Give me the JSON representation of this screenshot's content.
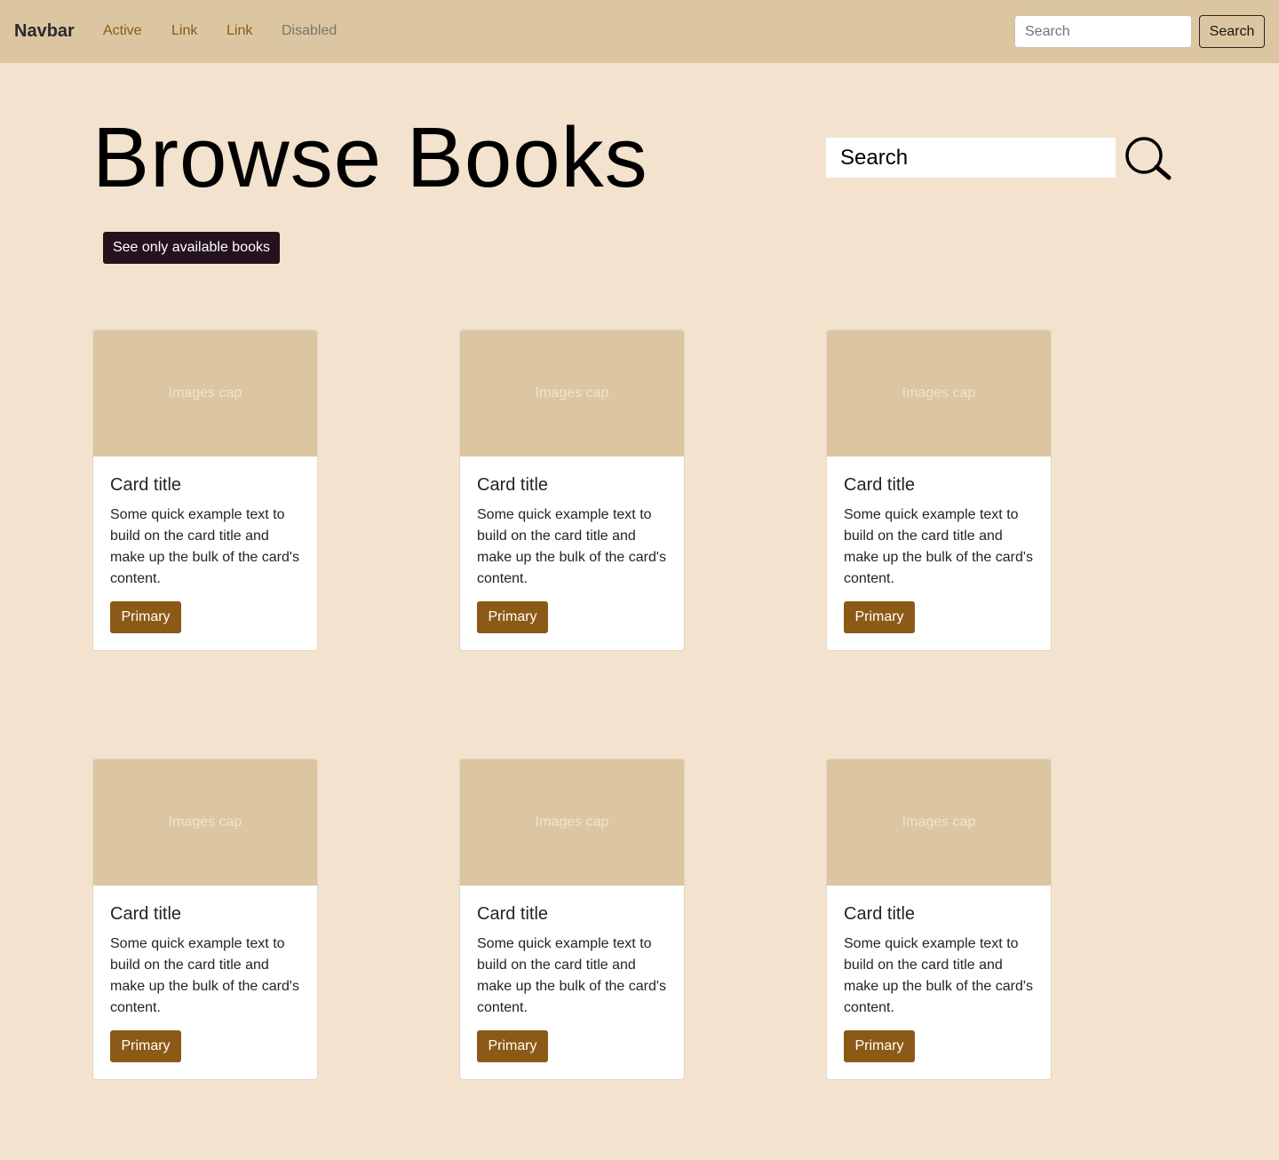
{
  "navbar": {
    "brand": "Navbar",
    "links": [
      {
        "label": "Active",
        "state": "active"
      },
      {
        "label": "Link",
        "state": "normal"
      },
      {
        "label": "Link",
        "state": "normal"
      },
      {
        "label": "Disabled",
        "state": "disabled"
      }
    ],
    "search_placeholder": "Search",
    "search_button": "Search"
  },
  "header": {
    "title": "Browse Books",
    "search_placeholder": "Search",
    "filter_button": "See only available books"
  },
  "cards": [
    {
      "image_caption": "Images cap",
      "title": "Card title",
      "text": "Some quick example text to build on the card title and make up the bulk of the card's content.",
      "button": "Primary"
    },
    {
      "image_caption": "Images cap",
      "title": "Card title",
      "text": "Some quick example text to build on the card title and make up the bulk of the card's content.",
      "button": "Primary"
    },
    {
      "image_caption": "Images cap",
      "title": "Card title",
      "text": "Some quick example text to build on the card title and make up the bulk of the card's content.",
      "button": "Primary"
    },
    {
      "image_caption": "Images cap",
      "title": "Card title",
      "text": "Some quick example text to build on the card title and make up the bulk of the card's content.",
      "button": "Primary"
    },
    {
      "image_caption": "Images cap",
      "title": "Card title",
      "text": "Some quick example text to build on the card title and make up the bulk of the card's content.",
      "button": "Primary"
    },
    {
      "image_caption": "Images cap",
      "title": "Card title",
      "text": "Some quick example text to build on the card title and make up the bulk of the card's content.",
      "button": "Primary"
    }
  ],
  "colors": {
    "page_background": "#f2e2ce",
    "navbar_background": "#dbc6a1",
    "accent": "#8b5a16",
    "filter_button": "#24131c"
  },
  "icons": {
    "hero_search": "search-icon"
  }
}
